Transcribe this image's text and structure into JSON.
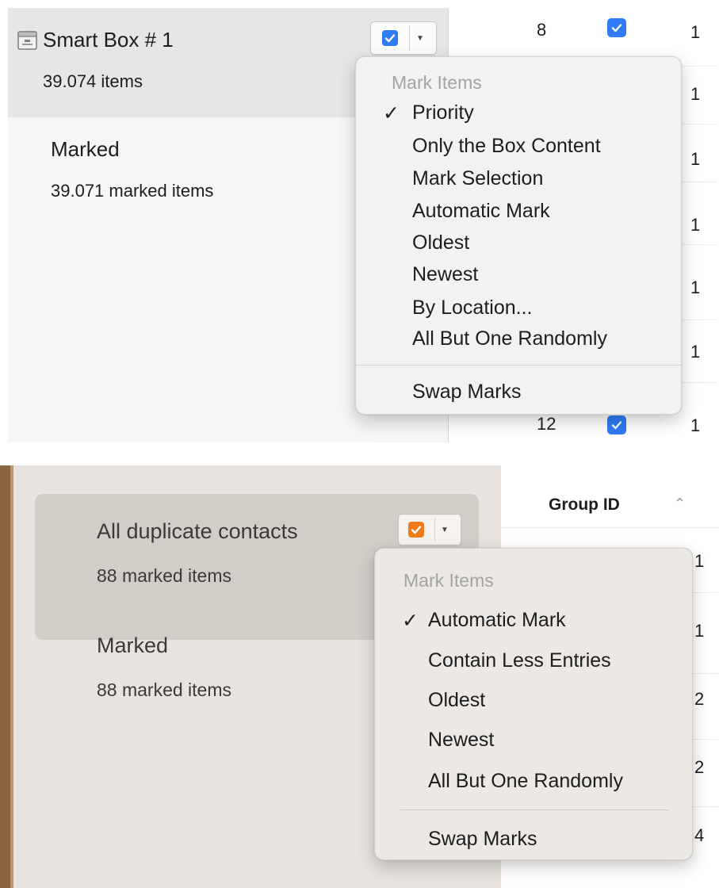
{
  "panel1": {
    "selected_item": {
      "title": "Smart Box # 1",
      "subtitle": "39.074 items"
    },
    "marked_item": {
      "title": "Marked",
      "subtitle": "39.071 marked items"
    },
    "table_top_count": "8",
    "table_bottom_count": "12",
    "table_group_values": [
      "1",
      "1",
      "1",
      "1",
      "1",
      "1",
      "1"
    ],
    "menu": {
      "header": "Mark Items",
      "checked_index": 0,
      "items": [
        "Priority",
        "Only the Box Content",
        "Mark Selection",
        "Automatic Mark",
        "Oldest",
        "Newest",
        "By Location...",
        "All But One Randomly"
      ],
      "footer_item": "Swap Marks"
    },
    "checkbox_color": "#2f7cf6"
  },
  "panel2": {
    "selected_item": {
      "title": "All duplicate contacts",
      "subtitle": "88 marked items"
    },
    "marked_item": {
      "title": "Marked",
      "subtitle": "88 marked items"
    },
    "table_header": "Group ID",
    "sort_icon": "chevron-up-icon",
    "table_group_values": [
      "1",
      "1",
      "2",
      "2",
      "4"
    ],
    "menu": {
      "header": "Mark Items",
      "checked_index": 0,
      "items": [
        "Automatic Mark",
        "Contain Less Entries",
        "Oldest",
        "Newest",
        "All But One Randomly"
      ],
      "footer_item": "Swap Marks"
    },
    "checkbox_color": "#f07a1a"
  }
}
